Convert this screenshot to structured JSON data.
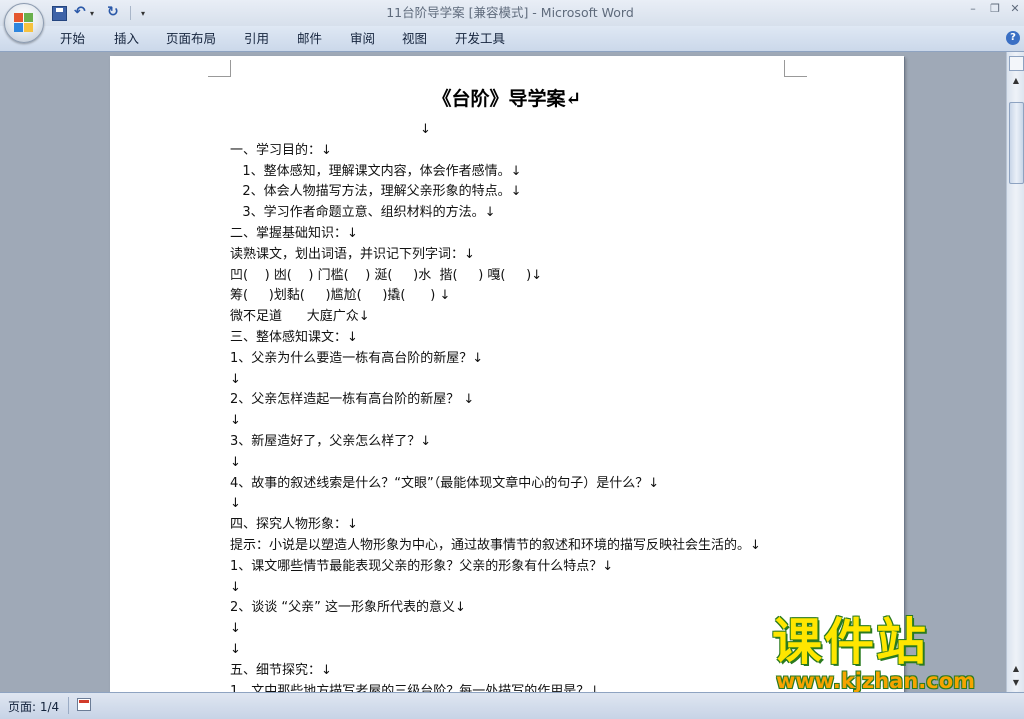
{
  "window": {
    "title": "11台阶导学案 [兼容模式] - Microsoft Word",
    "min_label": "–",
    "max_label": "❐",
    "close_label": "✕"
  },
  "quick_access": {
    "undo": "↶",
    "redo": "↻",
    "dropdown": "▾",
    "customize": "▾"
  },
  "ribbon": {
    "tabs": [
      "开始",
      "插入",
      "页面布局",
      "引用",
      "邮件",
      "审阅",
      "视图",
      "开发工具"
    ],
    "help": "?"
  },
  "document": {
    "title": "《台阶》导学案↵",
    "lines": [
      "↓",
      "一、学习目的：↓",
      "   1、整体感知，理解课文内容，体会作者感情。↓",
      "   2、体会人物描写方法，理解父亲形象的特点。↓",
      "   3、学习作者命题立意、组织材料的方法。↓",
      "二、掌握基础知识：↓",
      "读熟课文，划出词语，并识记下列字词：↓",
      "凹(    ) 凼(    ) 门槛(    ) 涎(     )水  揩(     ) 嘎(     )↓",
      "筹(     )划黏(     )尴尬(     )撬(      ) ↓",
      "微不足道      大庭广众↓",
      "三、整体感知课文：↓",
      "1、父亲为什么要造一栋有高台阶的新屋？↓",
      "↓",
      "2、父亲怎样造起一栋有高台阶的新屋？ ↓",
      "↓",
      "3、新屋造好了，父亲怎么样了？↓",
      "↓",
      "4、故事的叙述线索是什么？“文眼”（最能体现文章中心的句子）是什么？↓",
      "↓",
      "四、探究人物形象：↓",
      "提示：小说是以塑造人物形象为中心，通过故事情节的叙述和环境的描写反映社会生活的。↓",
      "1、课文哪些情节最能表现父亲的形象？父亲的形象有什么特点？↓",
      "↓",
      "2、谈谈 “父亲” 这一形象所代表的意义↓",
      "↓",
      "↓",
      "五、细节探究：↓",
      "1、文中那些地方描写老屋的三级台阶？每一处描写的作用是？↓"
    ]
  },
  "scrollbar": {
    "up": "▲",
    "prev": "▲",
    "next": "▼"
  },
  "status": {
    "page": "页面: 1/4"
  },
  "watermark": {
    "text": "课件站",
    "url": "www.kjzhan.com"
  }
}
